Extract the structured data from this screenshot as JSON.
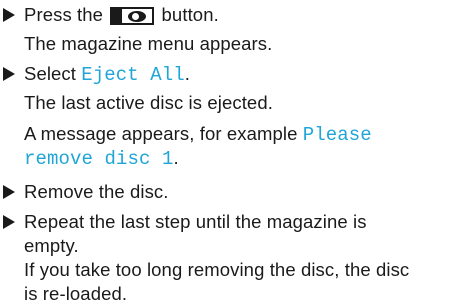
{
  "steps": [
    {
      "text_before": "Press the",
      "text_after": "button.",
      "result": "The magazine menu appears.",
      "button_icon": "disc-button-icon"
    },
    {
      "text_before": "Select ",
      "code": "Eject All",
      "text_after": ".",
      "result": "The last active disc is ejected.",
      "note_before": "A message appears, for example ",
      "note_code_1": "Please",
      "note_code_2": "remove disc 1",
      "note_after": "."
    },
    {
      "text": "Remove the disc."
    },
    {
      "text_line1": "Repeat the last step until the magazine is",
      "text_line2": "empty.",
      "result_line1": "If you take too long removing the disc, the disc",
      "result_line2": "is re-loaded."
    }
  ],
  "colors": {
    "text": "#1a1a1a",
    "code": "#1fa6d6"
  }
}
